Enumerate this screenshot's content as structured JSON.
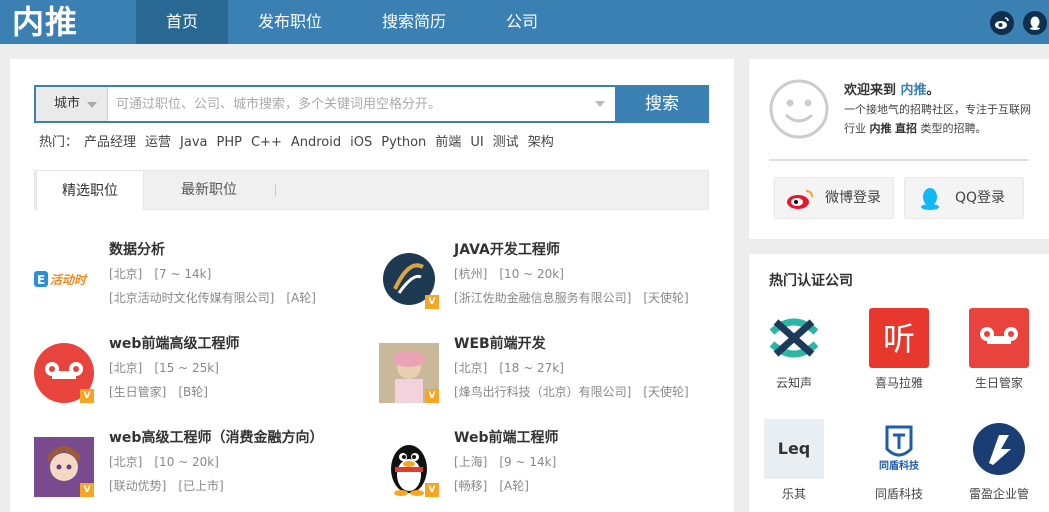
{
  "brand": "内推",
  "nav": {
    "items": [
      {
        "label": "首页",
        "active": true
      },
      {
        "label": "发布职位"
      },
      {
        "label": "搜索简历"
      },
      {
        "label": "公司"
      }
    ],
    "icons": [
      "weibo-icon",
      "qq-icon"
    ]
  },
  "search": {
    "city_label": "城市",
    "placeholder": "可通过职位、公司、城市搜索，多个关键词用空格分开。",
    "button_label": "搜索",
    "accent_color": "#3b80b3"
  },
  "hot": {
    "label": "热门：",
    "keywords": [
      "产品经理",
      "运营",
      "Java",
      "PHP",
      "C++",
      "Android",
      "iOS",
      "Python",
      "前端",
      "UI",
      "测试",
      "架构"
    ]
  },
  "tabs": [
    {
      "label": "精选职位",
      "active": true
    },
    {
      "label": "最新职位"
    }
  ],
  "jobs": [
    {
      "title": "数据分析",
      "city": "[北京]",
      "salary": "[7 ~ 14k]",
      "company": "[北京活动时文化传媒有限公司]",
      "stage": "[A轮]",
      "logo": "huodongshi-logo",
      "logo_text": "E活动时",
      "verified": false
    },
    {
      "title": "JAVA开发工程师",
      "city": "[杭州]",
      "salary": "[10 ~ 20k]",
      "company": "[浙江佐助金融信息服务有限公司]",
      "stage": "[天使轮]",
      "logo": "zuozhu-logo",
      "verified": true
    },
    {
      "title": "web前端高级工程师",
      "city": "[北京]",
      "salary": "[15 ~ 25k]",
      "company": "[生日管家]",
      "stage": "[B轮]",
      "logo": "shengri-logo",
      "verified": true
    },
    {
      "title": "WEB前端开发",
      "city": "[北京]",
      "salary": "[18 ~ 27k]",
      "company": "[烽鸟出行科技（北京）有限公司]",
      "stage": "[天使轮]",
      "logo": "photo-logo",
      "verified": true
    },
    {
      "title": "web高级工程师（消费金融方向）",
      "city": "[北京]",
      "salary": "[10 ~ 20k]",
      "company": "[联动优势]",
      "stage": "[已上市]",
      "logo": "anime-avatar-logo",
      "verified": true
    },
    {
      "title": "Web前端工程师",
      "city": "[上海]",
      "salary": "[9 ~ 14k]",
      "company": "[畅移]",
      "stage": "[A轮]",
      "logo": "penguin-logo",
      "verified": true
    }
  ],
  "login": {
    "welcome_prefix": "欢迎来到 ",
    "welcome_brand": "内推",
    "welcome_suffix": "。",
    "intro_part1": "一个接地气的招聘社区，专注于互联网行业 ",
    "intro_bold1": "内推",
    "intro_sep": " ",
    "intro_bold2": "直招",
    "intro_part2": " 类型的招聘。",
    "weibo_label": "微博登录",
    "qq_label": "QQ登录"
  },
  "companies": {
    "title": "热门认证公司",
    "items": [
      {
        "name": "云知声",
        "logo": "yunzhisheng-logo"
      },
      {
        "name": "喜马拉雅",
        "logo": "ximalaya-logo",
        "logo_text": "听"
      },
      {
        "name": "生日管家",
        "logo": "shengri-logo"
      },
      {
        "name": "乐其",
        "logo": "leqi-logo",
        "logo_text": "Leq"
      },
      {
        "name": "同盾科技",
        "logo": "tongdun-logo",
        "logo_text": "同盾科技"
      },
      {
        "name": "雷盈企业管",
        "logo": "leiying-logo"
      }
    ]
  }
}
